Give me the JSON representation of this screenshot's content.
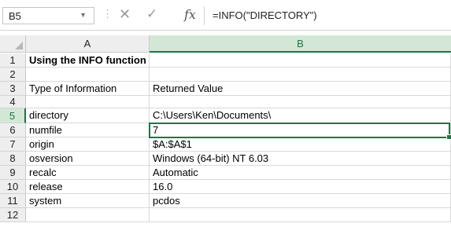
{
  "formula_bar": {
    "name_box": "B5",
    "formula": "=INFO(\"DIRECTORY\")",
    "fx_label": "fx"
  },
  "columns": [
    "A",
    "B"
  ],
  "rows": [
    {
      "num": "1",
      "a": "Using the INFO function",
      "b": "",
      "bold": true
    },
    {
      "num": "2",
      "a": "",
      "b": ""
    },
    {
      "num": "3",
      "a": "Type of Information",
      "b": "Returned Value"
    },
    {
      "num": "4",
      "a": "",
      "b": ""
    },
    {
      "num": "5",
      "a": "directory",
      "b": "C:\\Users\\Ken\\Documents\\",
      "selected": true
    },
    {
      "num": "6",
      "a": "numfile",
      "b": "7"
    },
    {
      "num": "7",
      "a": "origin",
      "b": "$A:$A$1"
    },
    {
      "num": "8",
      "a": "osversion",
      "b": "Windows (64-bit) NT 6.03"
    },
    {
      "num": "9",
      "a": "recalc",
      "b": "Automatic"
    },
    {
      "num": "10",
      "a": "release",
      "b": "16.0"
    },
    {
      "num": "11",
      "a": "system",
      "b": "pcdos"
    },
    {
      "num": "12",
      "a": "",
      "b": ""
    }
  ],
  "colors": {
    "accent": "#217346",
    "header_bg": "#eeeeee",
    "selected_header_bg": "#d3e7d7"
  }
}
